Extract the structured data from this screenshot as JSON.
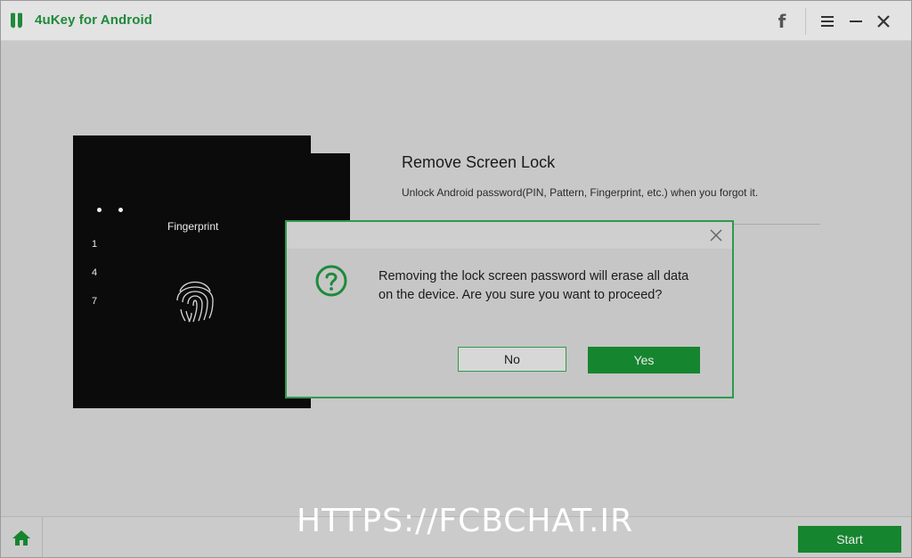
{
  "app": {
    "title": "4uKey for Android"
  },
  "titlebar": {
    "facebook_label": "f"
  },
  "feature": {
    "title": "Remove Screen Lock",
    "description": "Unlock Android password(PIN, Pattern, Fingerprint, etc.) when you forgot it."
  },
  "phones": {
    "fingerprint_label": "Fingerprint",
    "keypad": [
      "1",
      "4",
      "7"
    ]
  },
  "dialog": {
    "message": "Removing the lock screen password will erase all data on the device. Are you sure you want to proceed?",
    "no_label": "No",
    "yes_label": "Yes"
  },
  "footer": {
    "watermark": "HTTPS://FCBCHAT.IR",
    "start_label": "Start"
  },
  "colors": {
    "accent": "#16852f",
    "border_green": "#2e9a4e"
  },
  "icons": [
    "app-logo-icon",
    "facebook-icon",
    "menu-icon",
    "minimize-icon",
    "close-icon",
    "fingerprint-icon",
    "question-icon",
    "dialog-close-icon",
    "home-icon"
  ]
}
